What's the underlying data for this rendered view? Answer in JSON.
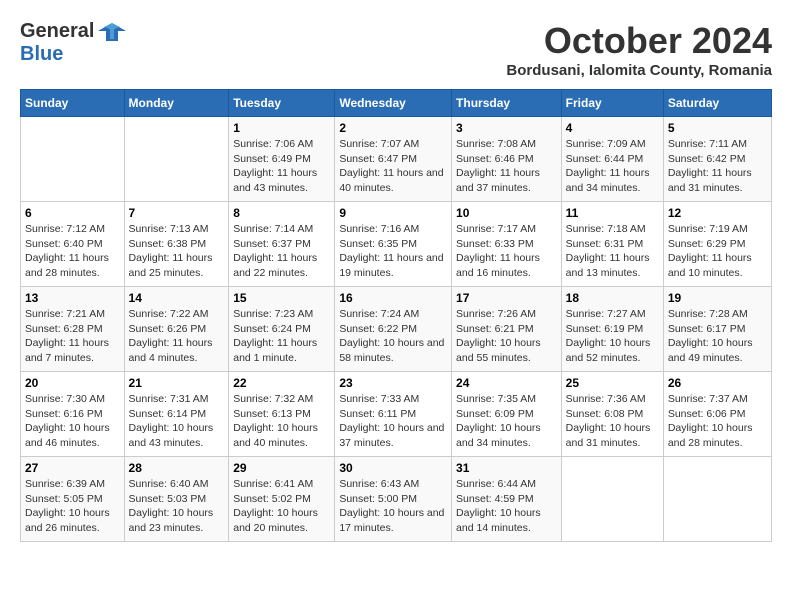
{
  "header": {
    "logo_general": "General",
    "logo_blue": "Blue",
    "month": "October 2024",
    "location": "Bordusani, Ialomita County, Romania"
  },
  "weekdays": [
    "Sunday",
    "Monday",
    "Tuesday",
    "Wednesday",
    "Thursday",
    "Friday",
    "Saturday"
  ],
  "weeks": [
    [
      {
        "day": "",
        "info": ""
      },
      {
        "day": "",
        "info": ""
      },
      {
        "day": "1",
        "info": "Sunrise: 7:06 AM\nSunset: 6:49 PM\nDaylight: 11 hours and 43 minutes."
      },
      {
        "day": "2",
        "info": "Sunrise: 7:07 AM\nSunset: 6:47 PM\nDaylight: 11 hours and 40 minutes."
      },
      {
        "day": "3",
        "info": "Sunrise: 7:08 AM\nSunset: 6:46 PM\nDaylight: 11 hours and 37 minutes."
      },
      {
        "day": "4",
        "info": "Sunrise: 7:09 AM\nSunset: 6:44 PM\nDaylight: 11 hours and 34 minutes."
      },
      {
        "day": "5",
        "info": "Sunrise: 7:11 AM\nSunset: 6:42 PM\nDaylight: 11 hours and 31 minutes."
      }
    ],
    [
      {
        "day": "6",
        "info": "Sunrise: 7:12 AM\nSunset: 6:40 PM\nDaylight: 11 hours and 28 minutes."
      },
      {
        "day": "7",
        "info": "Sunrise: 7:13 AM\nSunset: 6:38 PM\nDaylight: 11 hours and 25 minutes."
      },
      {
        "day": "8",
        "info": "Sunrise: 7:14 AM\nSunset: 6:37 PM\nDaylight: 11 hours and 22 minutes."
      },
      {
        "day": "9",
        "info": "Sunrise: 7:16 AM\nSunset: 6:35 PM\nDaylight: 11 hours and 19 minutes."
      },
      {
        "day": "10",
        "info": "Sunrise: 7:17 AM\nSunset: 6:33 PM\nDaylight: 11 hours and 16 minutes."
      },
      {
        "day": "11",
        "info": "Sunrise: 7:18 AM\nSunset: 6:31 PM\nDaylight: 11 hours and 13 minutes."
      },
      {
        "day": "12",
        "info": "Sunrise: 7:19 AM\nSunset: 6:29 PM\nDaylight: 11 hours and 10 minutes."
      }
    ],
    [
      {
        "day": "13",
        "info": "Sunrise: 7:21 AM\nSunset: 6:28 PM\nDaylight: 11 hours and 7 minutes."
      },
      {
        "day": "14",
        "info": "Sunrise: 7:22 AM\nSunset: 6:26 PM\nDaylight: 11 hours and 4 minutes."
      },
      {
        "day": "15",
        "info": "Sunrise: 7:23 AM\nSunset: 6:24 PM\nDaylight: 11 hours and 1 minute."
      },
      {
        "day": "16",
        "info": "Sunrise: 7:24 AM\nSunset: 6:22 PM\nDaylight: 10 hours and 58 minutes."
      },
      {
        "day": "17",
        "info": "Sunrise: 7:26 AM\nSunset: 6:21 PM\nDaylight: 10 hours and 55 minutes."
      },
      {
        "day": "18",
        "info": "Sunrise: 7:27 AM\nSunset: 6:19 PM\nDaylight: 10 hours and 52 minutes."
      },
      {
        "day": "19",
        "info": "Sunrise: 7:28 AM\nSunset: 6:17 PM\nDaylight: 10 hours and 49 minutes."
      }
    ],
    [
      {
        "day": "20",
        "info": "Sunrise: 7:30 AM\nSunset: 6:16 PM\nDaylight: 10 hours and 46 minutes."
      },
      {
        "day": "21",
        "info": "Sunrise: 7:31 AM\nSunset: 6:14 PM\nDaylight: 10 hours and 43 minutes."
      },
      {
        "day": "22",
        "info": "Sunrise: 7:32 AM\nSunset: 6:13 PM\nDaylight: 10 hours and 40 minutes."
      },
      {
        "day": "23",
        "info": "Sunrise: 7:33 AM\nSunset: 6:11 PM\nDaylight: 10 hours and 37 minutes."
      },
      {
        "day": "24",
        "info": "Sunrise: 7:35 AM\nSunset: 6:09 PM\nDaylight: 10 hours and 34 minutes."
      },
      {
        "day": "25",
        "info": "Sunrise: 7:36 AM\nSunset: 6:08 PM\nDaylight: 10 hours and 31 minutes."
      },
      {
        "day": "26",
        "info": "Sunrise: 7:37 AM\nSunset: 6:06 PM\nDaylight: 10 hours and 28 minutes."
      }
    ],
    [
      {
        "day": "27",
        "info": "Sunrise: 6:39 AM\nSunset: 5:05 PM\nDaylight: 10 hours and 26 minutes."
      },
      {
        "day": "28",
        "info": "Sunrise: 6:40 AM\nSunset: 5:03 PM\nDaylight: 10 hours and 23 minutes."
      },
      {
        "day": "29",
        "info": "Sunrise: 6:41 AM\nSunset: 5:02 PM\nDaylight: 10 hours and 20 minutes."
      },
      {
        "day": "30",
        "info": "Sunrise: 6:43 AM\nSunset: 5:00 PM\nDaylight: 10 hours and 17 minutes."
      },
      {
        "day": "31",
        "info": "Sunrise: 6:44 AM\nSunset: 4:59 PM\nDaylight: 10 hours and 14 minutes."
      },
      {
        "day": "",
        "info": ""
      },
      {
        "day": "",
        "info": ""
      }
    ]
  ]
}
